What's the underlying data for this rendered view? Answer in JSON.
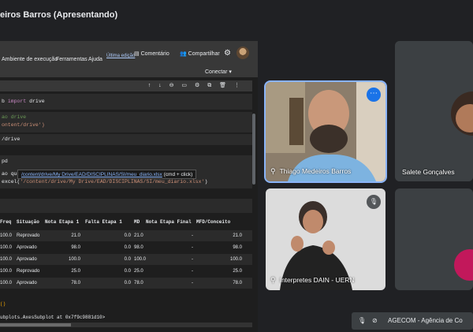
{
  "meeting": {
    "title": "eiros Barros (Apresentando)"
  },
  "colab": {
    "menus": [
      "Ambiente de execução",
      "Ferramentas",
      "Ajuda"
    ],
    "edit_note": "Última edição",
    "comment": "Comentário",
    "share": "Compartilhar",
    "connect": "Conectar",
    "toolbar_icons": "↑ ↓ ⊖ ▭ ⚙ ⧉ 🗑 ⋮",
    "code": {
      "import_prefix": "b",
      "import_kw": "import",
      "import_mod": "drive",
      "comment1": "ao drive",
      "comment2": "ontent/drive')",
      "mount_line": "/drive",
      "pd_line": "pd",
      "tooltip_prefix": "ao que t",
      "tooltip_link": "/content/drive/My Drive/EAD/DISCIPLINAS/SI/meu_diario.xlsx",
      "tooltip_suffix": "(cmd + click)",
      "excel_prefix": "excel(",
      "excel_path": "'/content/drive/My Drive/EAD/DISCIPLINAS/SI/meu_diario.xlsx'",
      "excel_suffix": ")"
    },
    "table": {
      "headers": [
        "Freq",
        "Situação",
        "Nota Etapa 1",
        "Falta Etapa 1",
        "MD",
        "Nota Etapa Final",
        "MFD/Conceito"
      ],
      "rows": [
        [
          "100.0",
          "Reprovado",
          "21.0",
          "0.0",
          "21.0",
          "-",
          "21.0"
        ],
        [
          "100.0",
          "Aprovado",
          "98.0",
          "0.0",
          "98.0",
          "-",
          "98.0"
        ],
        [
          "100.0",
          "Aprovado",
          "100.0",
          "0.0",
          "100.0",
          "-",
          "100.0"
        ],
        [
          "100.0",
          "Reprovado",
          "25.0",
          "0.0",
          "25.0",
          "-",
          "25.0"
        ],
        [
          "100.0",
          "Aprovado",
          "78.0",
          "0.0",
          "78.0",
          "-",
          "78.0"
        ]
      ]
    },
    "output": {
      "line1": "()",
      "line2": "ubplots.AxesSubplot at 0x7f9c9881d10>"
    }
  },
  "participants": [
    {
      "name": "Thiago Medeiros Barros"
    },
    {
      "name": "Salete Gonçalves"
    },
    {
      "name": "Interpretes DAIN - UERN"
    }
  ],
  "notification": {
    "text": "AGECOM - Agência de Co"
  },
  "colors": {
    "accent": "#8ab4f8",
    "danger": "#c2185b",
    "background": "#202124"
  }
}
